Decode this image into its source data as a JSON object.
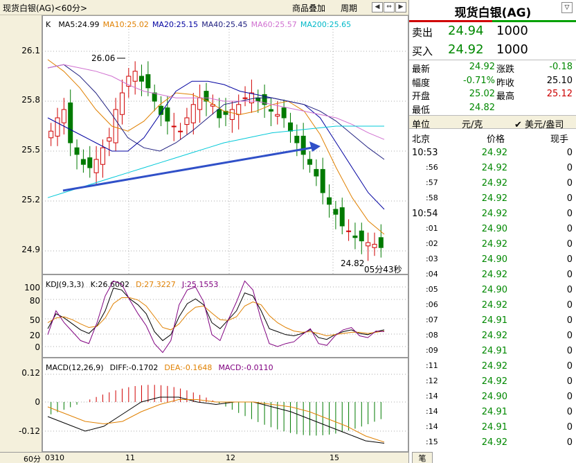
{
  "header": {
    "title": "现货白银(AG)<60分>",
    "btn_overlay": "商品叠加",
    "btn_period": "周期",
    "nav_left": "◀",
    "nav_right": "▶",
    "nav_extra": "⇔"
  },
  "colors": {
    "ma5": "#000000",
    "ma10": "#e08000",
    "ma20": "#0000a0",
    "ma40": "#202080",
    "ma60": "#d070d0",
    "ma200": "#00c8d8",
    "up": "#d00000",
    "down": "#007a00",
    "arrow": "#3050c8"
  },
  "main_legend": {
    "k": "K",
    "ma5": "MA5:24.99",
    "ma10": "MA10:25.02",
    "ma20": "MA20:25.15",
    "ma40": "MA40:25.45",
    "ma60": "MA60:25.57",
    "ma200": "MA200:25.65"
  },
  "main_axis": [
    "26.1",
    "25.8",
    "25.5",
    "25.2",
    "24.9"
  ],
  "annotations": {
    "high": "26.06",
    "low": "24.82",
    "countdown": "05分43秒"
  },
  "kdj_legend": {
    "name": "KDJ(9,3,3)",
    "k": "K:26.6002",
    "d": "D:27.3227",
    "j": "J:25.1553"
  },
  "kdj_axis": [
    "100",
    "80",
    "50",
    "20",
    "0"
  ],
  "macd_legend": {
    "name": "MACD(12,26,9)",
    "diff": "DIFF:-0.1702",
    "dea": "DEA:-0.1648",
    "macd": "MACD:-0.0110"
  },
  "macd_axis": [
    "0.12",
    "0",
    "-0.12"
  ],
  "x_axis": {
    "period": "60分",
    "labels": [
      "0310",
      "11",
      "12",
      "15"
    ]
  },
  "quote": {
    "title": "现货白银(AG)",
    "sell_label": "卖出",
    "sell_price": "24.94",
    "sell_vol": "1000",
    "buy_label": "买入",
    "buy_price": "24.92",
    "buy_vol": "1000",
    "stats": [
      {
        "l1": "最新",
        "v1": "24.92",
        "c1": "#008800",
        "l2": "涨跌",
        "v2": "-0.18",
        "c2": "#008800"
      },
      {
        "l1": "幅度",
        "v1": "-0.71%",
        "c1": "#008800",
        "l2": "昨收",
        "v2": "25.10",
        "c2": "#000000"
      },
      {
        "l1": "开盘",
        "v1": "25.02",
        "c1": "#008800",
        "l2": "最高",
        "v2": "25.12",
        "c2": "#cc0000"
      },
      {
        "l1": "最低",
        "v1": "24.82",
        "c1": "#008800",
        "l2": "",
        "v2": "",
        "c2": "#000000"
      }
    ],
    "unit_label": "单位",
    "unit_value": "元/克",
    "unit_alt": "✔ 美元/盎司",
    "ticks_header": {
      "time": "北京",
      "price": "价格",
      "vol": "现手"
    },
    "ticks": [
      {
        "time": "10:53",
        "price": "24.92",
        "vol": "0"
      },
      {
        "time": ":56",
        "price": "24.92",
        "vol": "0"
      },
      {
        "time": ":57",
        "price": "24.92",
        "vol": "0"
      },
      {
        "time": ":58",
        "price": "24.92",
        "vol": "0"
      },
      {
        "time": "10:54",
        "price": "24.92",
        "vol": "0"
      },
      {
        "time": ":01",
        "price": "24.90",
        "vol": "0"
      },
      {
        "time": ":02",
        "price": "24.92",
        "vol": "0"
      },
      {
        "time": ":03",
        "price": "24.90",
        "vol": "0"
      },
      {
        "time": ":04",
        "price": "24.92",
        "vol": "0"
      },
      {
        "time": ":05",
        "price": "24.90",
        "vol": "0"
      },
      {
        "time": ":06",
        "price": "24.92",
        "vol": "0"
      },
      {
        "time": ":07",
        "price": "24.91",
        "vol": "0"
      },
      {
        "time": ":08",
        "price": "24.92",
        "vol": "0"
      },
      {
        "time": ":09",
        "price": "24.91",
        "vol": "0"
      },
      {
        "time": ":11",
        "price": "24.92",
        "vol": "0"
      },
      {
        "time": ":12",
        "price": "24.92",
        "vol": "0"
      },
      {
        "time": ":14",
        "price": "24.90",
        "vol": "0"
      },
      {
        "time": ":14",
        "price": "24.91",
        "vol": "0"
      },
      {
        "time": ":14",
        "price": "24.91",
        "vol": "0"
      },
      {
        "time": ":15",
        "price": "24.92",
        "vol": "0"
      }
    ],
    "bottom_tab": "笔"
  }
}
